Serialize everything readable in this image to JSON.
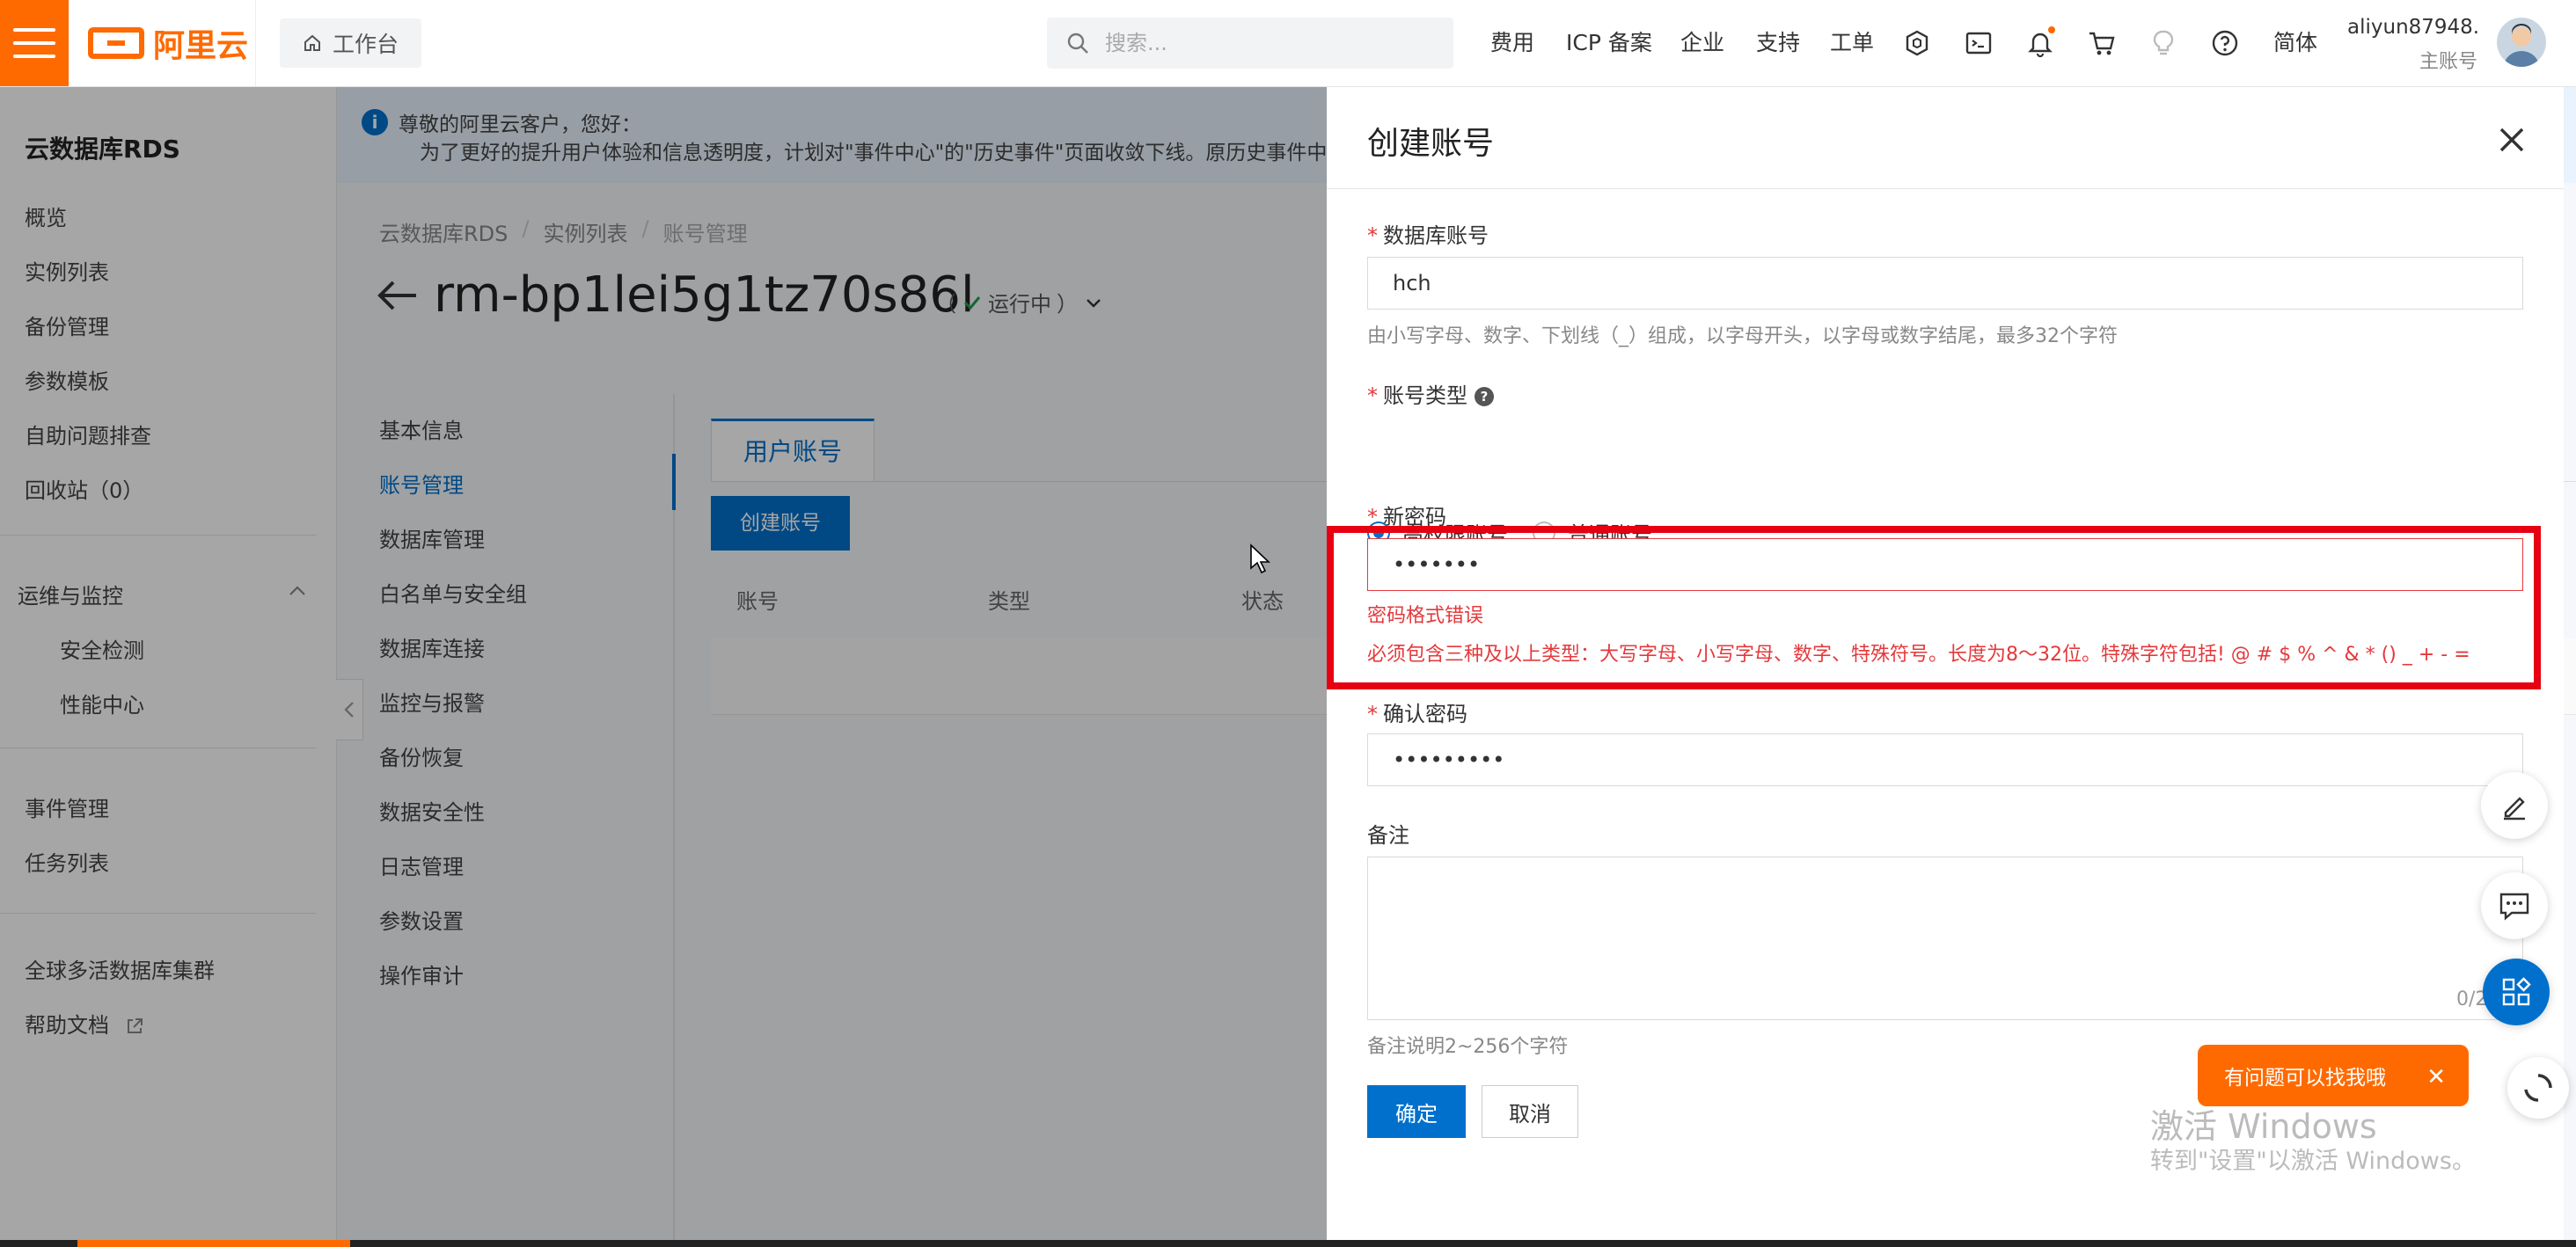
{
  "header": {
    "logo_text": "阿里云",
    "workbench": "工作台",
    "search_placeholder": "搜索...",
    "nav": [
      "费用",
      "ICP 备案",
      "企业",
      "支持",
      "工单"
    ],
    "lang": "简体",
    "user_name": "aliyun87948...",
    "user_role": "主账号"
  },
  "sidebar": {
    "title": "云数据库RDS",
    "items": [
      "概览",
      "实例列表",
      "备份管理",
      "参数模板",
      "自助问题排查",
      "回收站（0）"
    ],
    "group": "运维与监控",
    "group_items": [
      "安全检测",
      "性能中心"
    ],
    "items2": [
      "事件管理",
      "任务列表"
    ],
    "items3": [
      "全球多活数据库集群",
      "帮助文档"
    ]
  },
  "notice": {
    "line1": "尊敬的阿里云客户，您好：",
    "line2": "为了更好的提升用户体验和信息透明度，计划对\"事件中心\"的\"历史事件\"页面收敛下线。原历史事件中"
  },
  "breadcrumb": [
    "云数据库RDS",
    "/",
    "实例列表",
    "/",
    "账号管理"
  ],
  "instance": {
    "id": "rm-bp1lei5g1tz70s86l",
    "status": "运行中"
  },
  "subnav": [
    "基本信息",
    "账号管理",
    "数据库管理",
    "白名单与安全组",
    "数据库连接",
    "监控与报警",
    "备份恢复",
    "数据安全性",
    "日志管理",
    "参数设置",
    "操作审计"
  ],
  "content": {
    "tab": "用户账号",
    "create_button": "创建账号",
    "columns": [
      "账号",
      "类型",
      "状态"
    ]
  },
  "drawer": {
    "title": "创建账号",
    "account_label": "数据库账号",
    "account_value": "hch",
    "account_hint": "由小写字母、数字、下划线（_）组成，以字母开头，以字母或数字结尾，最多32个字符",
    "type_label": "账号类型",
    "type_options": [
      "高权限账号",
      "普通账号"
    ],
    "type_selected": "高权限账号",
    "password_label": "新密码",
    "password_value": "•••••••",
    "password_error": "密码格式错误",
    "password_rule": "必须包含三种及以上类型：大写字母、小写字母、数字、特殊符号。长度为8～32位。特殊字符包括! @ # $ % ^ & * () _ + - =",
    "confirm_label": "确认密码",
    "confirm_value": "•••••••••",
    "remark_label": "备注",
    "remark_counter": "0/2",
    "remark_hint": "备注说明2~256个字符",
    "ok_button": "确定",
    "cancel_button": "取消"
  },
  "floating": {
    "help_pill": "有问题可以找我哦",
    "watermark_title": "激活 Windows",
    "watermark_sub": "转到\"设置\"以激活 Windows。"
  },
  "colors": {
    "brand_orange": "#ff6a00",
    "primary_blue": "#0070cc",
    "error_red": "#e4393c",
    "annotation_red": "#e60012"
  }
}
